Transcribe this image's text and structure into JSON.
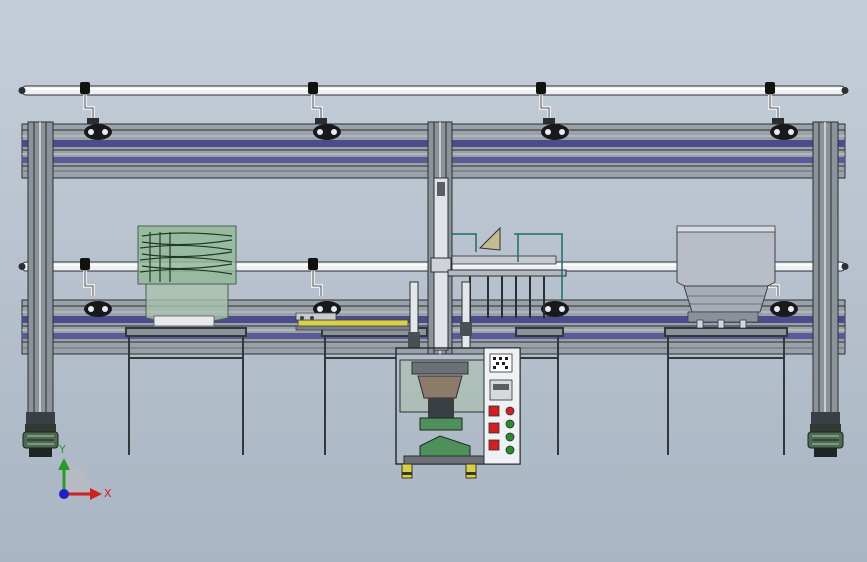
{
  "scene": {
    "view": "front",
    "background": "#b5c0cc",
    "components": [
      "overhead-rail",
      "upper-conveyor-beam",
      "lower-conveyor-beam",
      "support-column-left",
      "support-column-center",
      "support-column-right",
      "swivel-caster-left",
      "swivel-caster-right",
      "parts-bin-left",
      "vibratory-bowl-feeder-right",
      "linear-feeder-track",
      "press-machine",
      "control-panel",
      "workbench-1",
      "workbench-2",
      "workbench-3",
      "workbench-4"
    ],
    "colors": {
      "frame": "#8d939a",
      "frame_dark": "#3a3f45",
      "conveyor_belt": "#4b4c8c",
      "bin_glass": "#93b89a",
      "feeder_bowl": "#b9bdc7",
      "fixture_green": "#4f8f5c",
      "accent_yellow": "#d9d04a",
      "button_red": "#d12020",
      "button_green": "#2b8a2b"
    }
  },
  "triad": {
    "x_label": "X",
    "y_label": "Y",
    "x_color": "#d02020",
    "y_color": "#2a9a2a",
    "z_color": "#2020c8"
  }
}
